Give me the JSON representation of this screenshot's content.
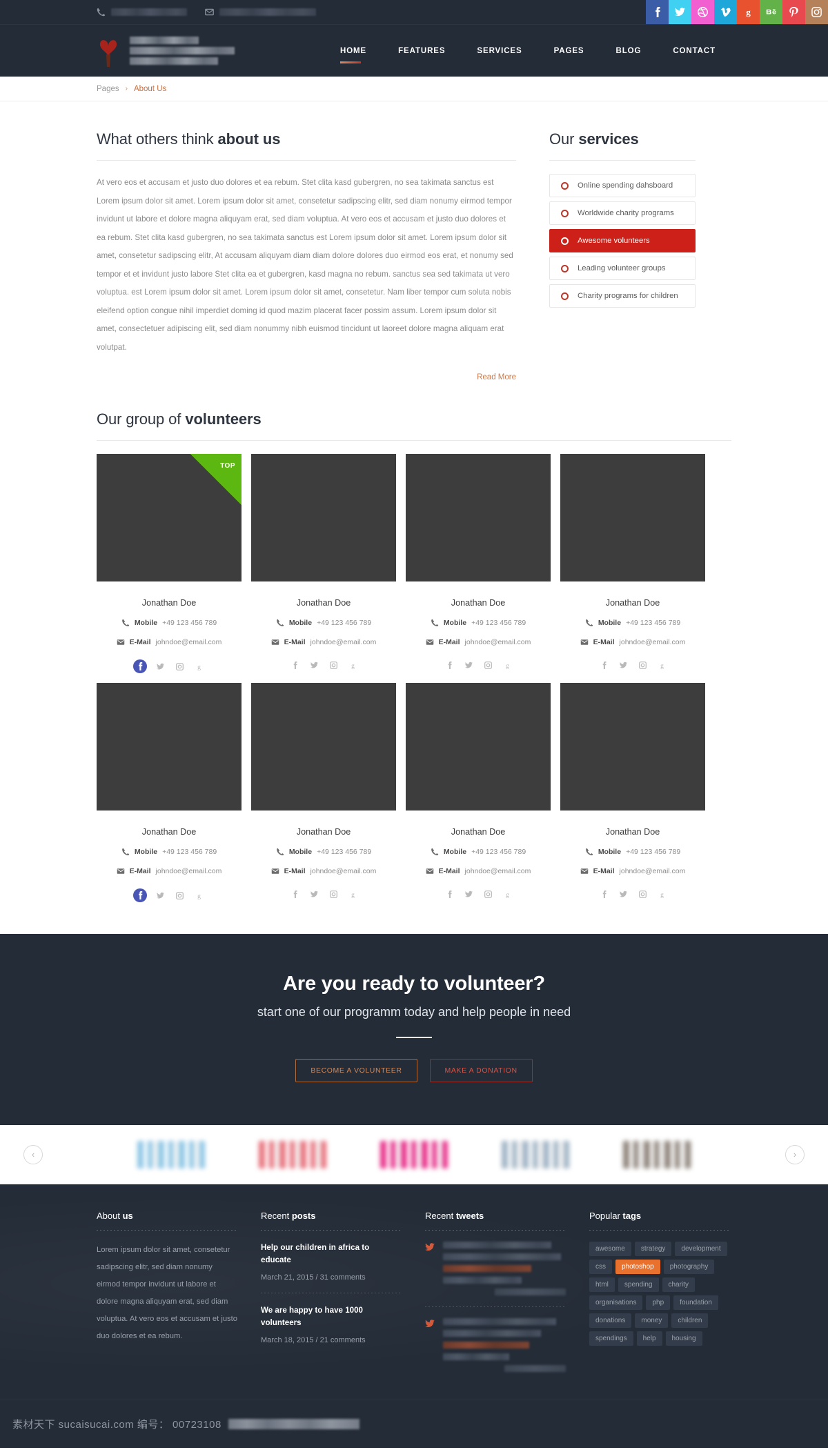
{
  "topbar": {
    "phone_icon": "phone-icon",
    "email_icon": "envelope-icon",
    "phone_redacted": true,
    "email_redacted": true,
    "socials": [
      {
        "name": "facebook",
        "glyph": "f",
        "color": "#3b5da7"
      },
      {
        "name": "twitter",
        "glyph": "bird",
        "color": "#3fd0f2"
      },
      {
        "name": "dribbble",
        "glyph": "ball",
        "color": "#f25fd0"
      },
      {
        "name": "vimeo",
        "glyph": "v",
        "color": "#1ea7d8"
      },
      {
        "name": "google-plus",
        "glyph": "g",
        "color": "#e8522e"
      },
      {
        "name": "behance",
        "glyph": "be",
        "color": "#62b149"
      },
      {
        "name": "pinterest",
        "glyph": "p",
        "color": "#e8494f"
      },
      {
        "name": "instagram",
        "glyph": "cam",
        "color": "#b5815a"
      }
    ]
  },
  "header": {
    "brand_redacted": true,
    "nav": [
      {
        "label": "HOME",
        "active": true
      },
      {
        "label": "FEATURES",
        "active": false
      },
      {
        "label": "SERVICES",
        "active": false
      },
      {
        "label": "PAGES",
        "active": false
      },
      {
        "label": "BLOG",
        "active": false
      },
      {
        "label": "CONTACT",
        "active": false
      }
    ]
  },
  "breadcrumb": {
    "root": "Pages",
    "separator": "›",
    "current": "About Us"
  },
  "about": {
    "heading_normal": "What others think ",
    "heading_bold": "about us",
    "paragraph": "At vero eos et accusam et justo duo dolores et ea rebum. Stet clita kasd gubergren, no sea takimata sanctus est Lorem ipsum dolor sit amet. Lorem ipsum dolor sit amet, consetetur sadipscing elitr, sed diam nonumy eirmod tempor invidunt ut labore et dolore magna aliquyam erat, sed diam voluptua. At vero eos et accusam et justo duo dolores et ea rebum. Stet clita kasd gubergren, no sea takimata sanctus est Lorem ipsum dolor sit amet. Lorem ipsum dolor sit amet, consetetur sadipscing elitr, At accusam aliquyam diam diam dolore dolores duo eirmod eos erat, et nonumy sed tempor et et invidunt justo labore Stet clita ea et gubergren, kasd magna no rebum. sanctus sea sed takimata ut vero voluptua. est Lorem ipsum dolor sit amet. Lorem ipsum dolor sit amet, consetetur. Nam liber tempor cum soluta nobis eleifend option congue nihil imperdiet doming id quod mazim placerat facer possim assum. Lorem ipsum dolor sit amet, consectetuer adipiscing elit, sed diam nonummy nibh euismod tincidunt ut laoreet dolore magna aliquam erat volutpat.",
    "read_more": "Read More"
  },
  "services": {
    "heading_normal": "Our ",
    "heading_bold": "services",
    "items": [
      {
        "label": "Online spending dahsboard",
        "active": false
      },
      {
        "label": "Worldwide charity programs",
        "active": false
      },
      {
        "label": "Awesome volunteers",
        "active": true
      },
      {
        "label": "Leading volunteer groups",
        "active": false
      },
      {
        "label": "Charity programs for children",
        "active": false
      }
    ]
  },
  "volunteers": {
    "heading_normal": "Our group of ",
    "heading_bold": "volunteers",
    "mobile_label": "Mobile",
    "email_label": "E-Mail",
    "badge_top": "TOP",
    "cards": [
      {
        "name": "Jonathan Doe",
        "mobile": "+49 123 456 789",
        "email": "johndoe@email.com",
        "top": true,
        "fb_active": true
      },
      {
        "name": "Jonathan Doe",
        "mobile": "+49 123 456 789",
        "email": "johndoe@email.com",
        "top": false,
        "fb_active": false
      },
      {
        "name": "Jonathan Doe",
        "mobile": "+49 123 456 789",
        "email": "johndoe@email.com",
        "top": false,
        "fb_active": false
      },
      {
        "name": "Jonathan Doe",
        "mobile": "+49 123 456 789",
        "email": "johndoe@email.com",
        "top": false,
        "fb_active": false
      },
      {
        "name": "Jonathan Doe",
        "mobile": "+49 123 456 789",
        "email": "johndoe@email.com",
        "top": false,
        "fb_active": true
      },
      {
        "name": "Jonathan Doe",
        "mobile": "+49 123 456 789",
        "email": "johndoe@email.com",
        "top": false,
        "fb_active": false
      },
      {
        "name": "Jonathan Doe",
        "mobile": "+49 123 456 789",
        "email": "johndoe@email.com",
        "top": false,
        "fb_active": false
      },
      {
        "name": "Jonathan Doe",
        "mobile": "+49 123 456 789",
        "email": "johndoe@email.com",
        "top": false,
        "fb_active": false
      }
    ],
    "card_socials": [
      "facebook-icon",
      "twitter-icon",
      "instagram-icon",
      "google-plus-icon"
    ]
  },
  "cta": {
    "title": "Are you ready to volunteer?",
    "subtitle": "start one of our programm today and help people in need",
    "button_volunteer": "BECOME A VOLUNTEER",
    "button_donation": "MAKE A DONATION"
  },
  "partners": {
    "prev": "‹",
    "next": "›",
    "logos": [
      {
        "name": "partner-logo-1",
        "tint": "#8ec6e6"
      },
      {
        "name": "partner-logo-2",
        "tint": "#e8727c"
      },
      {
        "name": "partner-logo-3",
        "tint": "#e8308a"
      },
      {
        "name": "partner-logo-4",
        "tint": "#9fb3c4"
      },
      {
        "name": "partner-logo-5",
        "tint": "#8d8279"
      }
    ]
  },
  "footer": {
    "about": {
      "heading_normal": "About ",
      "heading_bold": "us",
      "text": "Lorem ipsum dolor sit amet, consetetur sadipscing elitr, sed diam nonumy eirmod tempor invidunt ut labore et dolore magna aliquyam erat, sed diam voluptua. At vero eos et accusam et justo duo dolores et ea rebum."
    },
    "posts": {
      "heading_normal": "Recent ",
      "heading_bold": "posts",
      "items": [
        {
          "title": "Help our children in africa to educate",
          "meta": "March 21, 2015 / 31 comments"
        },
        {
          "title": "We are happy to have 1000 volunteers",
          "meta": "March 18, 2015 / 21 comments"
        }
      ]
    },
    "tweets": {
      "heading_normal": "Recent ",
      "heading_bold": "tweets",
      "redacted": true,
      "count": 2
    },
    "tags": {
      "heading_normal": "Popular ",
      "heading_bold": "tags",
      "items": [
        {
          "label": "awesome",
          "hot": false
        },
        {
          "label": "strategy",
          "hot": false
        },
        {
          "label": "development",
          "hot": false
        },
        {
          "label": "css",
          "hot": false
        },
        {
          "label": "photoshop",
          "hot": true
        },
        {
          "label": "photography",
          "hot": false
        },
        {
          "label": "html",
          "hot": false
        },
        {
          "label": "spending",
          "hot": false
        },
        {
          "label": "charity",
          "hot": false
        },
        {
          "label": "organisations",
          "hot": false
        },
        {
          "label": "php",
          "hot": false
        },
        {
          "label": "foundation",
          "hot": false
        },
        {
          "label": "donations",
          "hot": false
        },
        {
          "label": "money",
          "hot": false
        },
        {
          "label": "children",
          "hot": false
        },
        {
          "label": "spendings",
          "hot": false
        },
        {
          "label": "help",
          "hot": false
        },
        {
          "label": "housing",
          "hot": false
        }
      ]
    }
  },
  "watermark": {
    "text": "素材天下 sucaisucai.com  编号： 00723108"
  }
}
